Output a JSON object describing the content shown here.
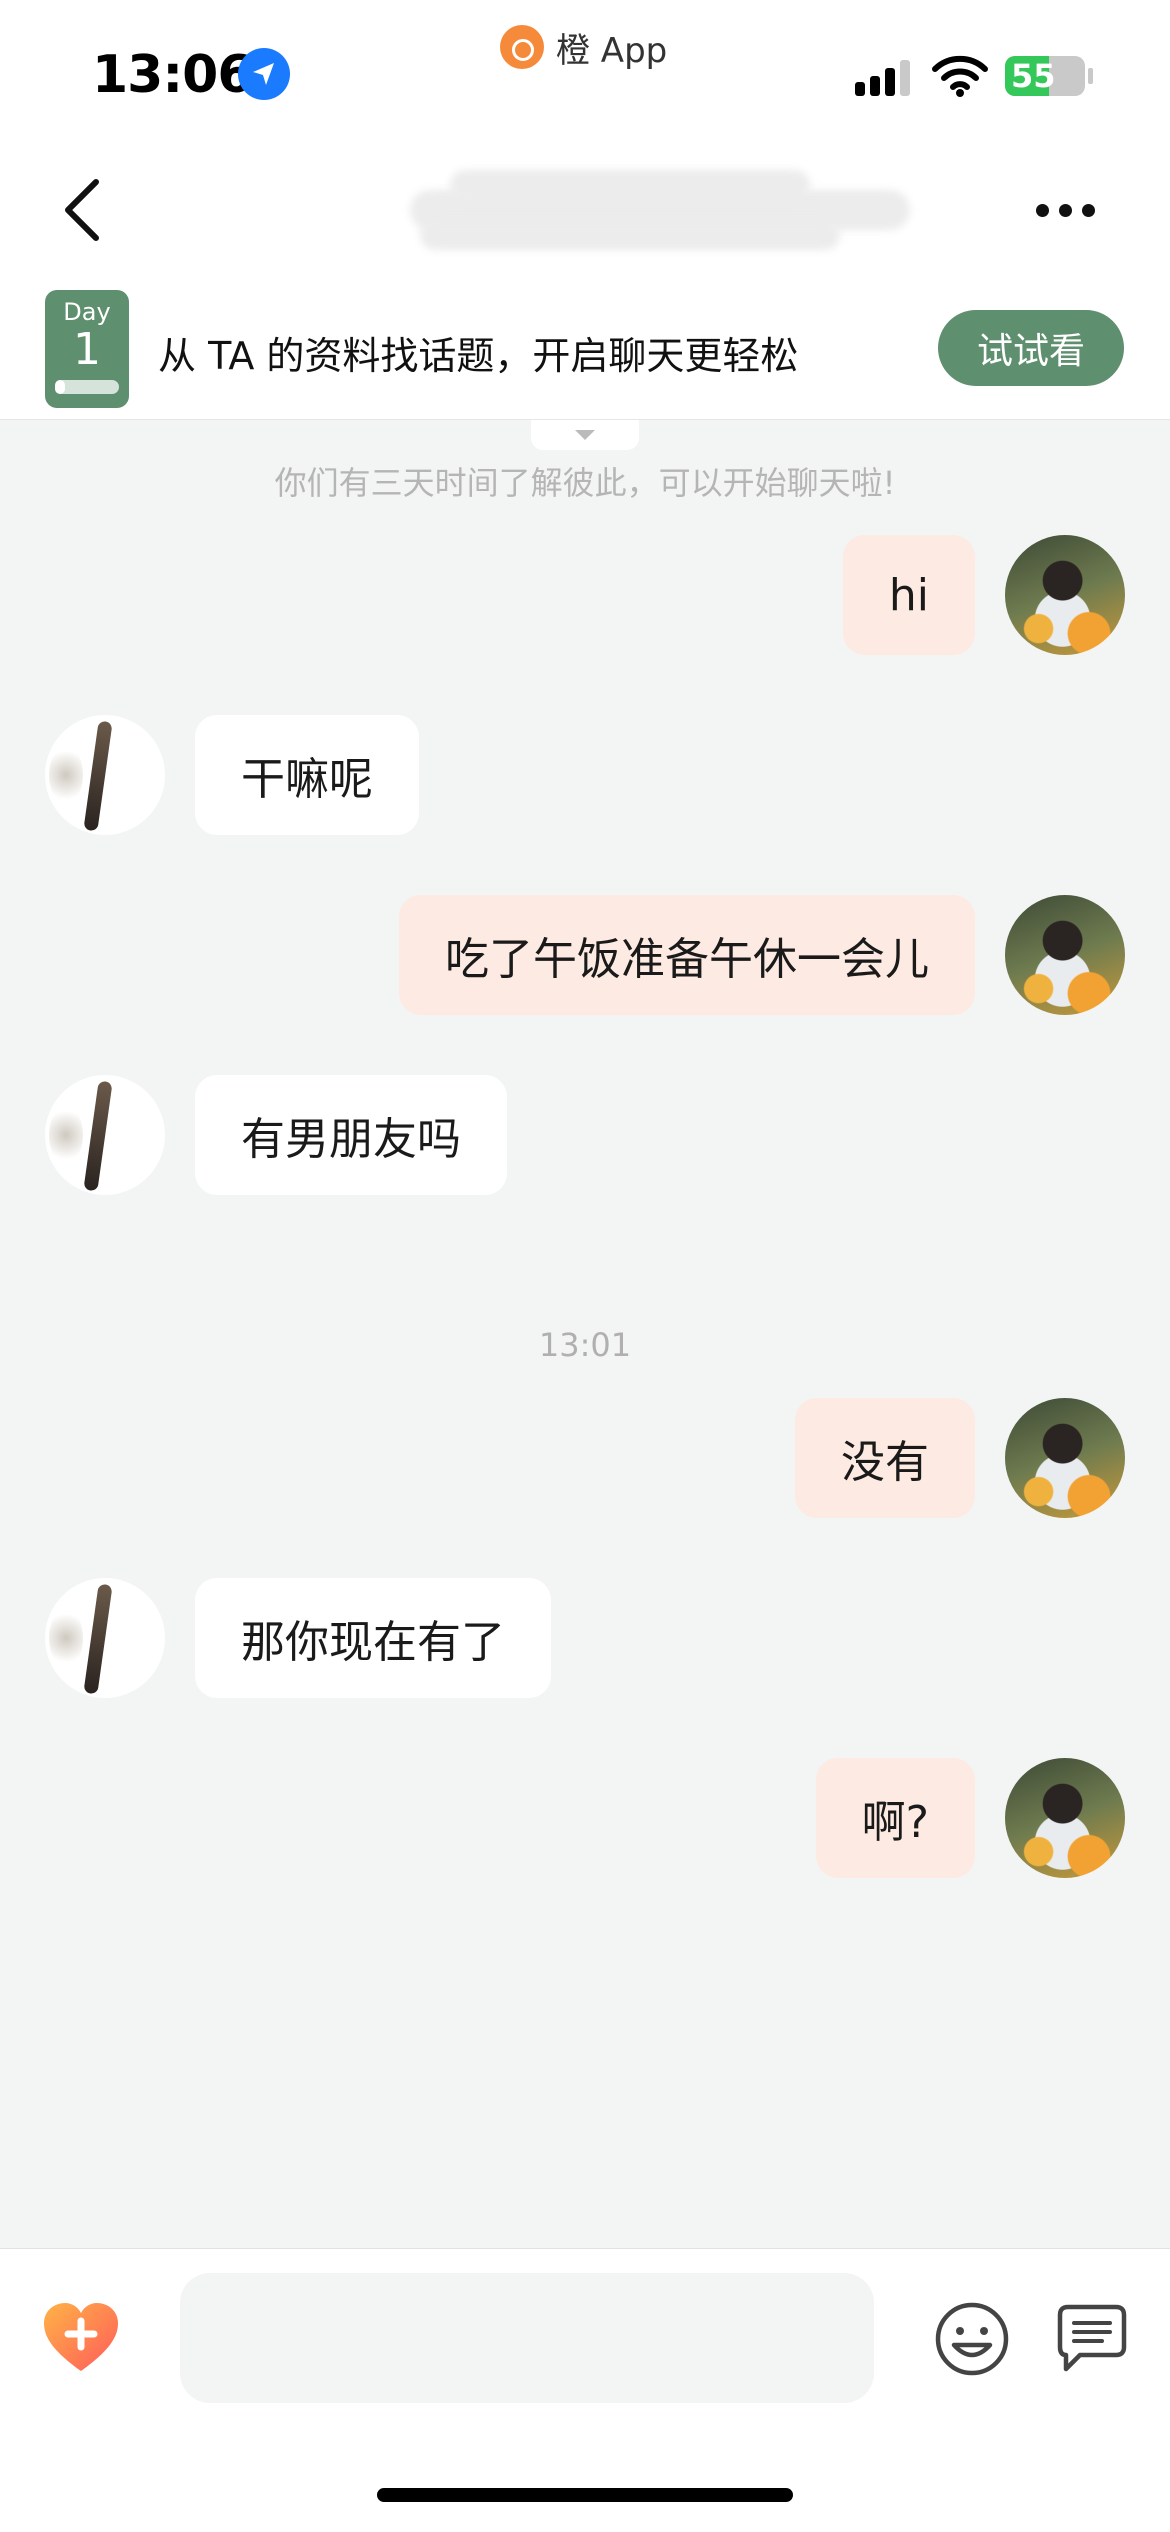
{
  "status_bar": {
    "time": "13:06",
    "app_name": "橙 App",
    "battery_level": "55",
    "battery_percent": 55,
    "location_icon": "location-arrow-icon",
    "signal_icon": "cellular-signal-icon",
    "wifi_icon": "wifi-icon",
    "battery_icon": "battery-charging-icon"
  },
  "nav": {
    "title": "",
    "back_icon": "chevron-left-icon",
    "more_icon": "more-dots-icon"
  },
  "tip_banner": {
    "day_label": "Day",
    "day_number": "1",
    "day_progress": 0.15,
    "text": "从 TA 的资料找话题，开启聊天更轻松",
    "button_label": "试试看",
    "accent_color": "#5e8f6f"
  },
  "system_note": "你们有三天时间了解彼此，可以开始聊天啦!",
  "time_stamp": "13:01",
  "messages": [
    {
      "sender": "me",
      "text": "hi"
    },
    {
      "sender": "peer",
      "text": "干嘛呢"
    },
    {
      "sender": "me",
      "text": "吃了午饭准备午休一会儿"
    },
    {
      "sender": "peer",
      "text": "有男朋友吗"
    },
    {
      "sender": "me",
      "text": "没有"
    },
    {
      "sender": "peer",
      "text": "那你现在有了"
    },
    {
      "sender": "me",
      "text": "啊?"
    }
  ],
  "colors": {
    "my_bubble": "#fdeae2",
    "peer_bubble": "#ffffff",
    "background": "#f3f4f4"
  },
  "input_bar": {
    "value": "",
    "placeholder": "",
    "heart_icon": "heart-plus-icon",
    "emoji_icon": "emoji-smile-icon",
    "chat_icon": "chat-bubble-icon"
  }
}
